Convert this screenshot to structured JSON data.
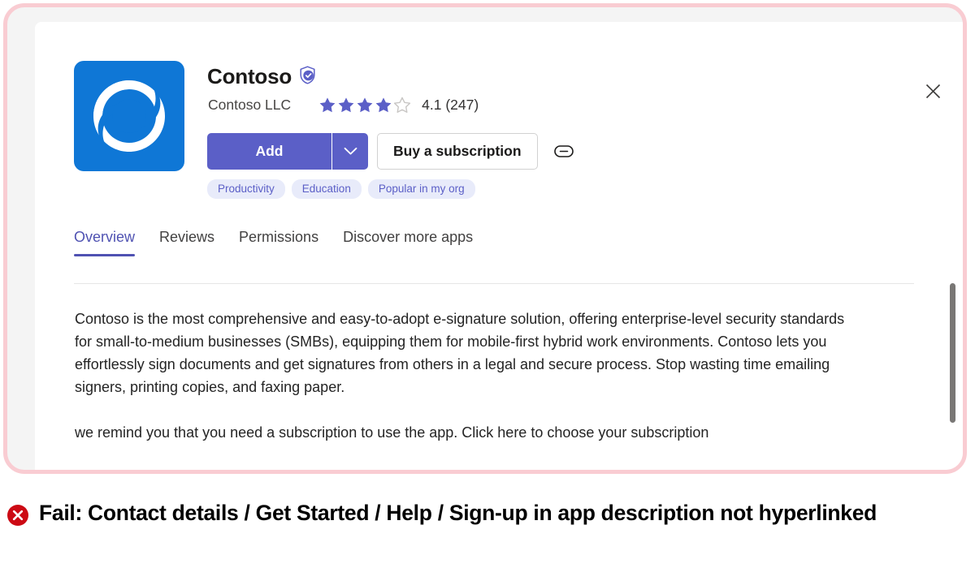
{
  "dialog": {
    "close_label": "close-icon",
    "app": {
      "icon_name": "contoso-app-icon",
      "icon_bg": "#0f77d6",
      "title": "Contoso",
      "verified_icon": "verified-shield-icon",
      "publisher": "Contoso LLC",
      "rating_value": 4.1,
      "rating_stars_filled": 4,
      "rating_stars_total": 5,
      "rating_text": "4.1 (247)",
      "review_count": 247
    },
    "actions": {
      "add_label": "Add",
      "add_caret_icon": "chevron-down-icon",
      "buy_label": "Buy a subscription",
      "link_icon": "link-chain-icon"
    },
    "tags": [
      "Productivity",
      "Education",
      "Popular in my org"
    ],
    "tabs": [
      {
        "label": "Overview",
        "active": true
      },
      {
        "label": "Reviews",
        "active": false
      },
      {
        "label": "Permissions",
        "active": false
      },
      {
        "label": "Discover more apps",
        "active": false
      }
    ],
    "description": {
      "paragraph_1": "Contoso is the most comprehensive and easy-to-adopt e-signature solution, offering enterprise-level security standards for small-to-medium businesses (SMBs), equipping them for mobile-first hybrid work environments. Contoso lets you effortlessly sign documents and get signatures from others in a legal and secure process. Stop wasting time emailing signers, printing copies, and faxing paper.",
      "paragraph_2": "we remind you that  you need a subscription to use the app. Click here to choose your subscription"
    },
    "scrollbar": {
      "name": "vertical-scrollbar"
    }
  },
  "caption": {
    "status_icon": "fail-circle-x-icon",
    "status_color": "#cc0a14",
    "text": "Fail: Contact details / Get Started / Help / Sign-up in app description not hyperlinked"
  },
  "colors": {
    "accent_purple": "#5b5fc7",
    "tab_active": "#4f52b2",
    "frame_pink": "#f9ccd2",
    "panel_gray": "#f4f4f4",
    "icon_blue": "#0f77d6"
  }
}
